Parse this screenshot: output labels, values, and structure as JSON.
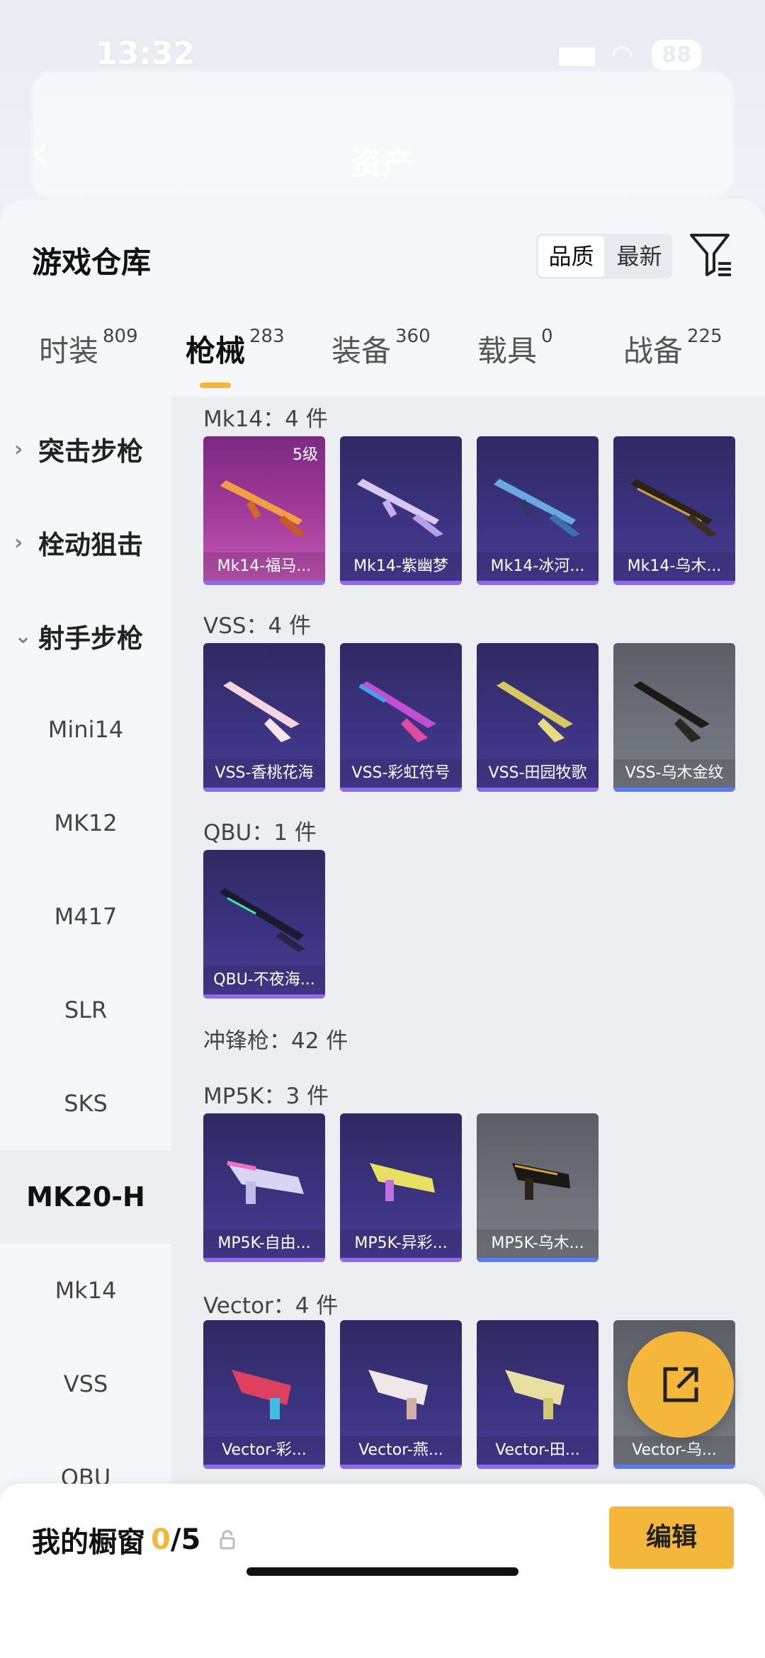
{
  "status": {
    "time": "13:32",
    "battery": "88"
  },
  "header": {
    "title": "资产"
  },
  "sheet": {
    "title": "游戏仓库",
    "sort_options": [
      "品质",
      "最新"
    ],
    "active_sort": "品质"
  },
  "tabs": [
    {
      "label": "时装",
      "count": "809"
    },
    {
      "label": "枪械",
      "count": "283"
    },
    {
      "label": "装备",
      "count": "360"
    },
    {
      "label": "载具",
      "count": "0"
    },
    {
      "label": "战备",
      "count": "225"
    }
  ],
  "active_tab": "枪械",
  "sidebar": {
    "groups": [
      "突击步枪",
      "栓动狙击",
      "射手步枪"
    ],
    "items": [
      "Mini14",
      "MK12",
      "M417",
      "SLR",
      "SKS",
      "MK20-H",
      "Mk14",
      "VSS",
      "QBU"
    ],
    "selected": "MK20-H"
  },
  "sections": {
    "mk14": {
      "label": "Mk14：4 件",
      "cards": [
        {
          "name": "Mk14-福马...",
          "level": "5级",
          "style": "pink"
        },
        {
          "name": "Mk14-紫幽梦",
          "style": "purple"
        },
        {
          "name": "Mk14-冰河...",
          "style": "purple"
        },
        {
          "name": "Mk14-乌木...",
          "style": "purple"
        }
      ]
    },
    "vss": {
      "label": "VSS：4 件",
      "cards": [
        {
          "name": "VSS-香桃花海",
          "style": "purple"
        },
        {
          "name": "VSS-彩虹符号",
          "style": "purple"
        },
        {
          "name": "VSS-田园牧歌",
          "style": "purple"
        },
        {
          "name": "VSS-乌木金纹",
          "style": "gray"
        }
      ]
    },
    "qbu": {
      "label": "QBU：1 件",
      "cards": [
        {
          "name": "QBU-不夜海...",
          "style": "purple"
        }
      ]
    },
    "smg": {
      "label": "冲锋枪：42 件"
    },
    "mp5k": {
      "label": "MP5K：3 件",
      "cards": [
        {
          "name": "MP5K-自由...",
          "style": "purple"
        },
        {
          "name": "MP5K-异彩...",
          "style": "purple"
        },
        {
          "name": "MP5K-乌木...",
          "style": "gray"
        }
      ]
    },
    "vector": {
      "label": "Vector：4 件",
      "cards": [
        {
          "name": "Vector-彩...",
          "style": "purple"
        },
        {
          "name": "Vector-燕...",
          "style": "purple"
        },
        {
          "name": "Vector-田...",
          "style": "purple"
        },
        {
          "name": "Vector-乌...",
          "style": "gray"
        }
      ]
    }
  },
  "bottom": {
    "showcase_label": "我的橱窗",
    "showcase_current": "0",
    "showcase_total": "/5",
    "edit_label": "编辑"
  },
  "colors": {
    "accent": "#f5b73b",
    "card_purple": "#3b3380",
    "card_pink": "#a23a98",
    "card_gray": "#6f727a"
  }
}
